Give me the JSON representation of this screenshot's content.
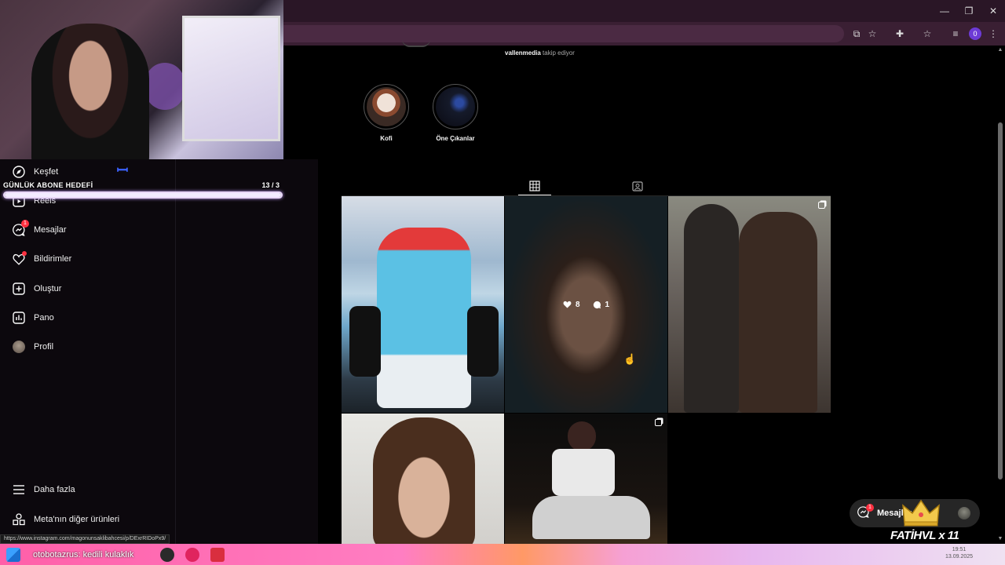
{
  "browser": {
    "window_controls": [
      "—",
      "❐",
      "✕"
    ],
    "profile_badge": "0"
  },
  "stream_overlay": {
    "goal_label": "GÜNLÜK ABONE HEDEFİ",
    "goal_count": "13 / 3",
    "goal_progress": 1.0,
    "gift_user": "FATİHVL x 11"
  },
  "sidebar": {
    "items": [
      {
        "label": "Keşfet",
        "icon": "compass-icon"
      },
      {
        "label": "Reels",
        "icon": "reels-icon"
      },
      {
        "label": "Mesajlar",
        "icon": "messenger-icon",
        "badge": "1"
      },
      {
        "label": "Bildirimler",
        "icon": "heart-icon"
      },
      {
        "label": "Oluştur",
        "icon": "plus-icon"
      },
      {
        "label": "Pano",
        "icon": "dashboard-icon"
      },
      {
        "label": "Profil",
        "icon": "avatar-icon"
      }
    ],
    "bottom_items": [
      {
        "label": "Daha fazla",
        "icon": "menu-icon"
      },
      {
        "label": "Meta'nın diğer ürünleri",
        "icon": "apps-icon"
      }
    ]
  },
  "profile": {
    "followed_by_user": "vallenmedia",
    "followed_by_text": "takip ediyor",
    "highlights": [
      {
        "label": "Kofi"
      },
      {
        "label": "Öne Çıkanlar"
      }
    ]
  },
  "posts": [
    {
      "overlay": false,
      "multi": false
    },
    {
      "overlay": true,
      "likes": "8",
      "comments": "1",
      "multi": false
    },
    {
      "overlay": false,
      "multi": true
    },
    {
      "overlay": false,
      "multi": false
    },
    {
      "overlay": false,
      "multi": true
    }
  ],
  "messages_pill": {
    "label": "Mesajlar",
    "badge": "1"
  },
  "status_url": "https://www.instagram.com/magonunsaklibahcesi/p/DExrRIDoPx9/",
  "taskbar": {
    "running_text": "otobotazrus: kedili kulaklık",
    "time": "19:51",
    "date": "13.09.2025"
  }
}
